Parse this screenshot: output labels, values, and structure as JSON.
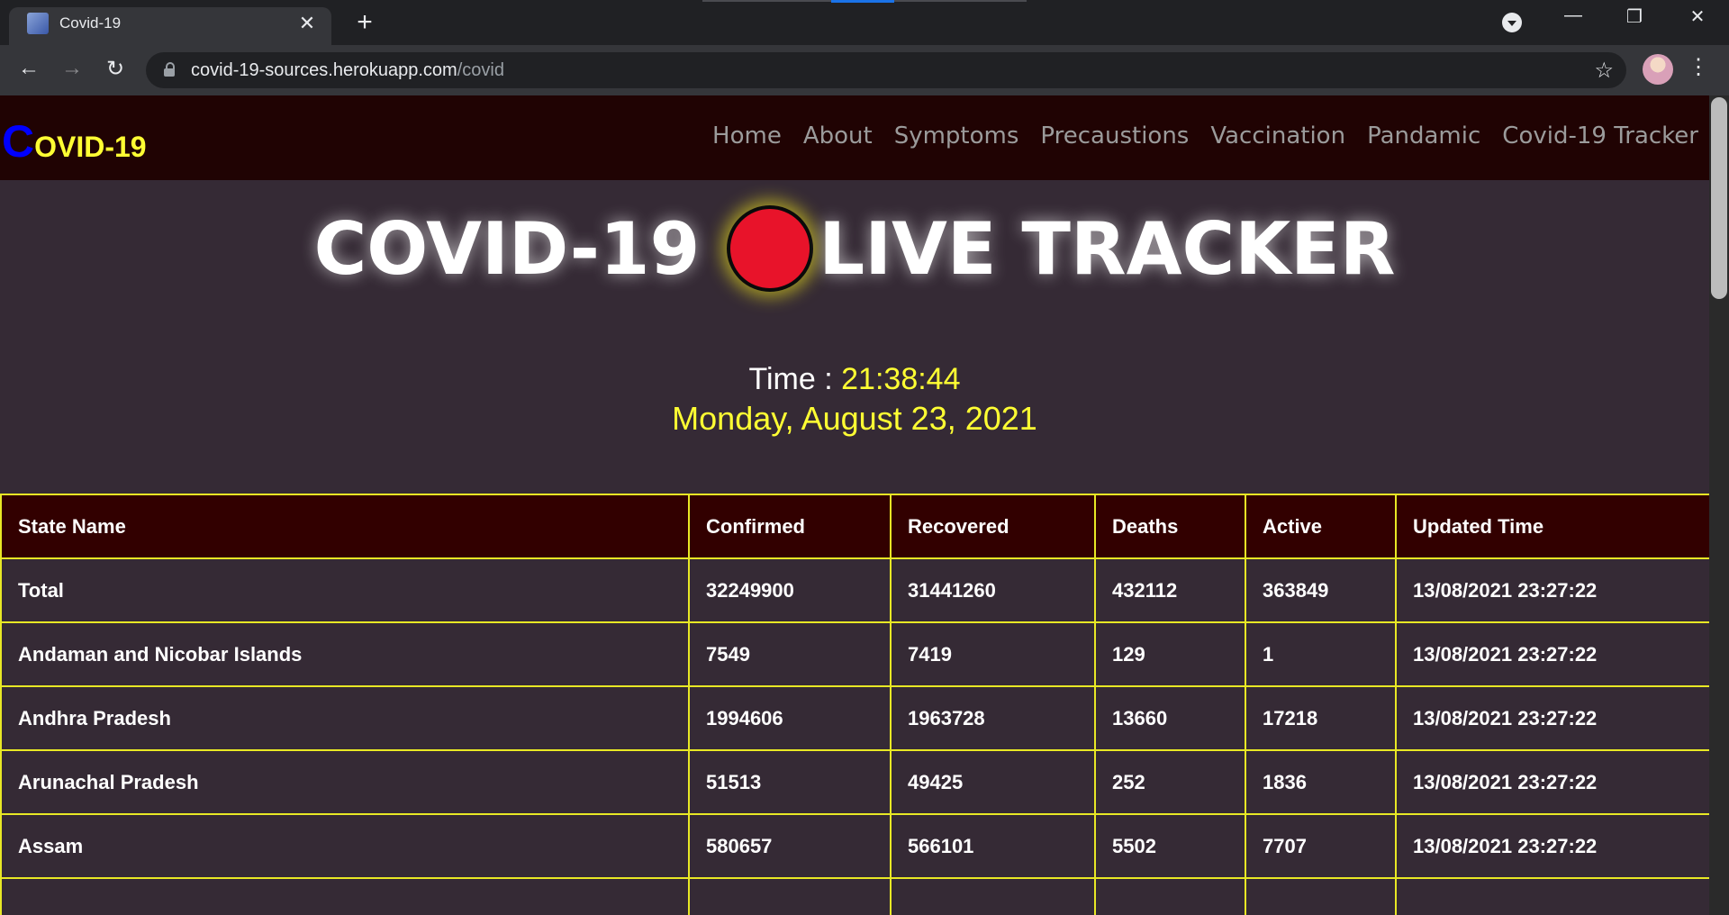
{
  "browser": {
    "tab_title": "Covid-19",
    "tab_close": "✕",
    "new_tab": "+",
    "url_host": "covid-19-sources.herokuapp.com",
    "url_path": "/covid",
    "controls": {
      "minimize": "—",
      "restore": "❐",
      "close": "✕"
    },
    "nav": {
      "back": "←",
      "forward": "→",
      "reload": "↻",
      "star": "☆",
      "menu": "⋮"
    }
  },
  "site": {
    "logo_first": "C",
    "logo_rest": "OVID-19",
    "nav": [
      "Home",
      "About",
      "Symptoms",
      "Precaustions",
      "Vaccination",
      "Pandamic",
      "Covid-19 Tracker"
    ]
  },
  "hero": {
    "left": "COVID-19",
    "right": "LIVE TRACKER"
  },
  "clock": {
    "label": "Time : ",
    "time": "21:38:44",
    "date": "Monday, August 23, 2021"
  },
  "table": {
    "headers": [
      "State Name",
      "Confirmed",
      "Recovered",
      "Deaths",
      "Active",
      "Updated Time"
    ],
    "rows": [
      [
        "Total",
        "32249900",
        "31441260",
        "432112",
        "363849",
        "13/08/2021 23:27:22"
      ],
      [
        "Andaman and Nicobar Islands",
        "7549",
        "7419",
        "129",
        "1",
        "13/08/2021 23:27:22"
      ],
      [
        "Andhra Pradesh",
        "1994606",
        "1963728",
        "13660",
        "17218",
        "13/08/2021 23:27:22"
      ],
      [
        "Arunachal Pradesh",
        "51513",
        "49425",
        "252",
        "1836",
        "13/08/2021 23:27:22"
      ],
      [
        "Assam",
        "580657",
        "566101",
        "5502",
        "7707",
        "13/08/2021 23:27:22"
      ],
      [
        "",
        "",
        "",
        "",
        "",
        ""
      ]
    ]
  },
  "colors": {
    "accent_yellow": "#ffff33",
    "logo_blue": "#0000ff",
    "live_red": "#e8132a",
    "table_border": "#e8e825",
    "header_bg": "#320000",
    "page_bg": "#352a35"
  }
}
